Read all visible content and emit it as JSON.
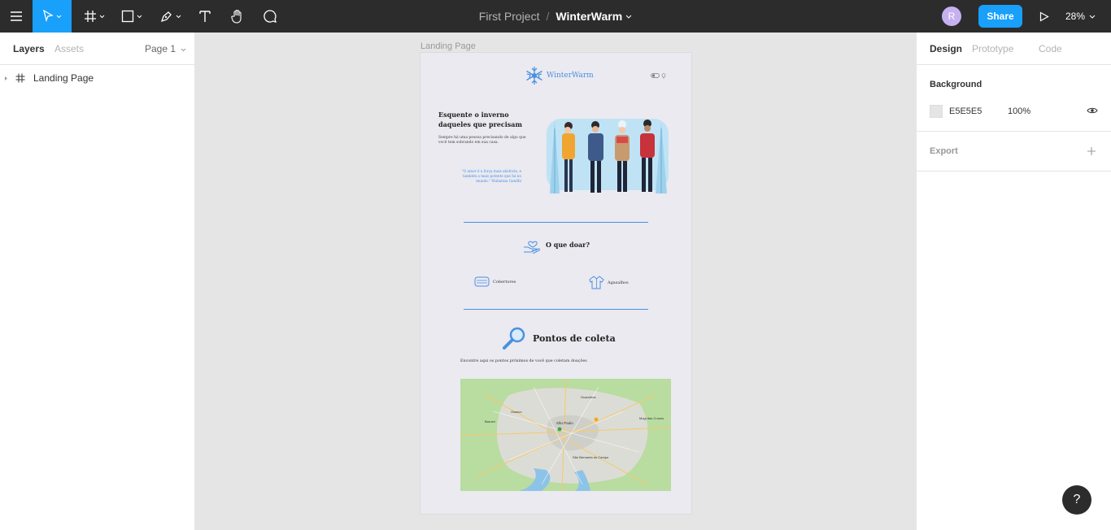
{
  "toolbar": {
    "project": "First Project",
    "separator": "/",
    "file_name": "WinterWarm",
    "avatar_initial": "R",
    "share_label": "Share",
    "zoom": "28%",
    "icons": [
      "menu-icon",
      "move-tool-icon",
      "frame-tool-icon",
      "shape-tool-icon",
      "pen-tool-icon",
      "text-tool-icon",
      "hand-tool-icon",
      "comment-tool-icon",
      "present-icon"
    ]
  },
  "left_panel": {
    "tabs": [
      "Layers",
      "Assets"
    ],
    "page_selector": "Page 1",
    "layers": [
      {
        "name": "Landing Page",
        "icon": "frame-icon"
      }
    ]
  },
  "canvas": {
    "frame_label": "Landing Page",
    "frame": {
      "logo_text": "WinterWarm",
      "hero_title": "Esquente o inverno daqueles que precisam",
      "hero_subtitle": "Sempre há uma pessoa precisando de algo que você tem sobrando em sua casa.",
      "quote": "\"O amor é a força mais abstrata, e também a mais potente que há no mundo.\" Mahatma Gandhi",
      "donate_title": "O que doar?",
      "items": [
        "Cobertores",
        "Agasalhos"
      ],
      "pontos_title": "Pontos de coleta",
      "pontos_subtitle": "Encontre aqui os pontos próximos de você que coletam doações",
      "map_labels": {
        "center": "São Paulo",
        "north": "Guarulhos",
        "south": "São Bernardo do Campo",
        "west": "Osasco",
        "east": "Mogi das Cruzes",
        "extra": "Barueri"
      }
    }
  },
  "right_panel": {
    "tabs": [
      "Design",
      "Prototype",
      "Code"
    ],
    "background_title": "Background",
    "background_hex": "E5E5E5",
    "background_opacity": "100%",
    "export_title": "Export"
  },
  "help_label": "?",
  "colors": {
    "toolbar_bg": "#2c2c2c",
    "accent": "#18a0fb",
    "canvas_bg": "#e5e5e5",
    "brand_blue": "#4a90e2"
  }
}
